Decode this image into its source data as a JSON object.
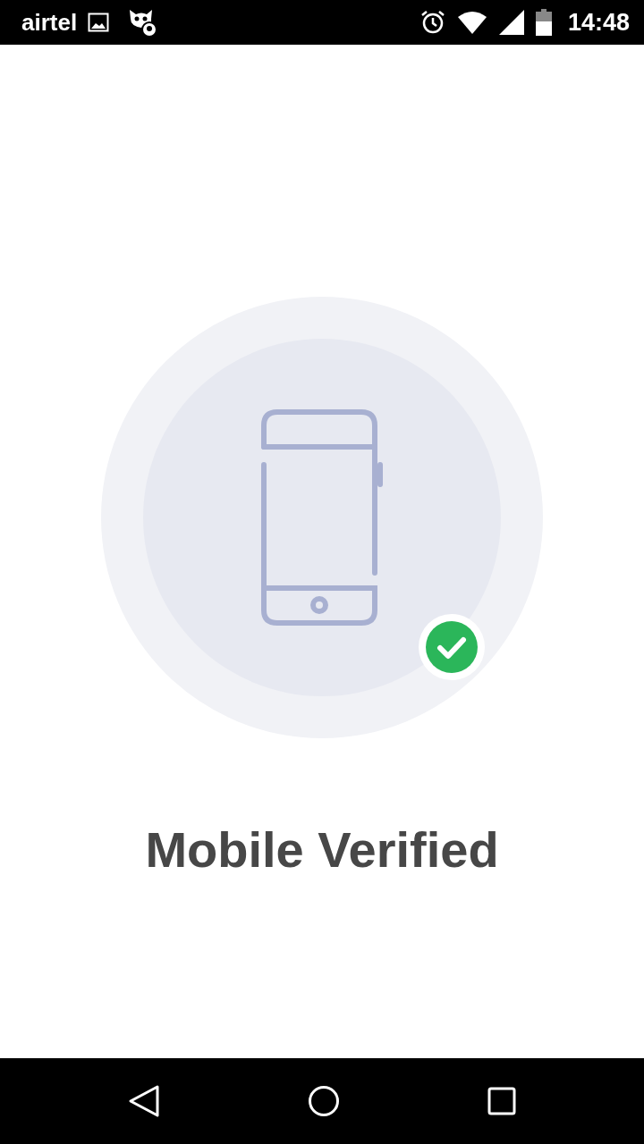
{
  "status_bar": {
    "carrier": "airtel",
    "time": "14:48"
  },
  "verification": {
    "title": "Mobile Verified",
    "verified": true
  }
}
